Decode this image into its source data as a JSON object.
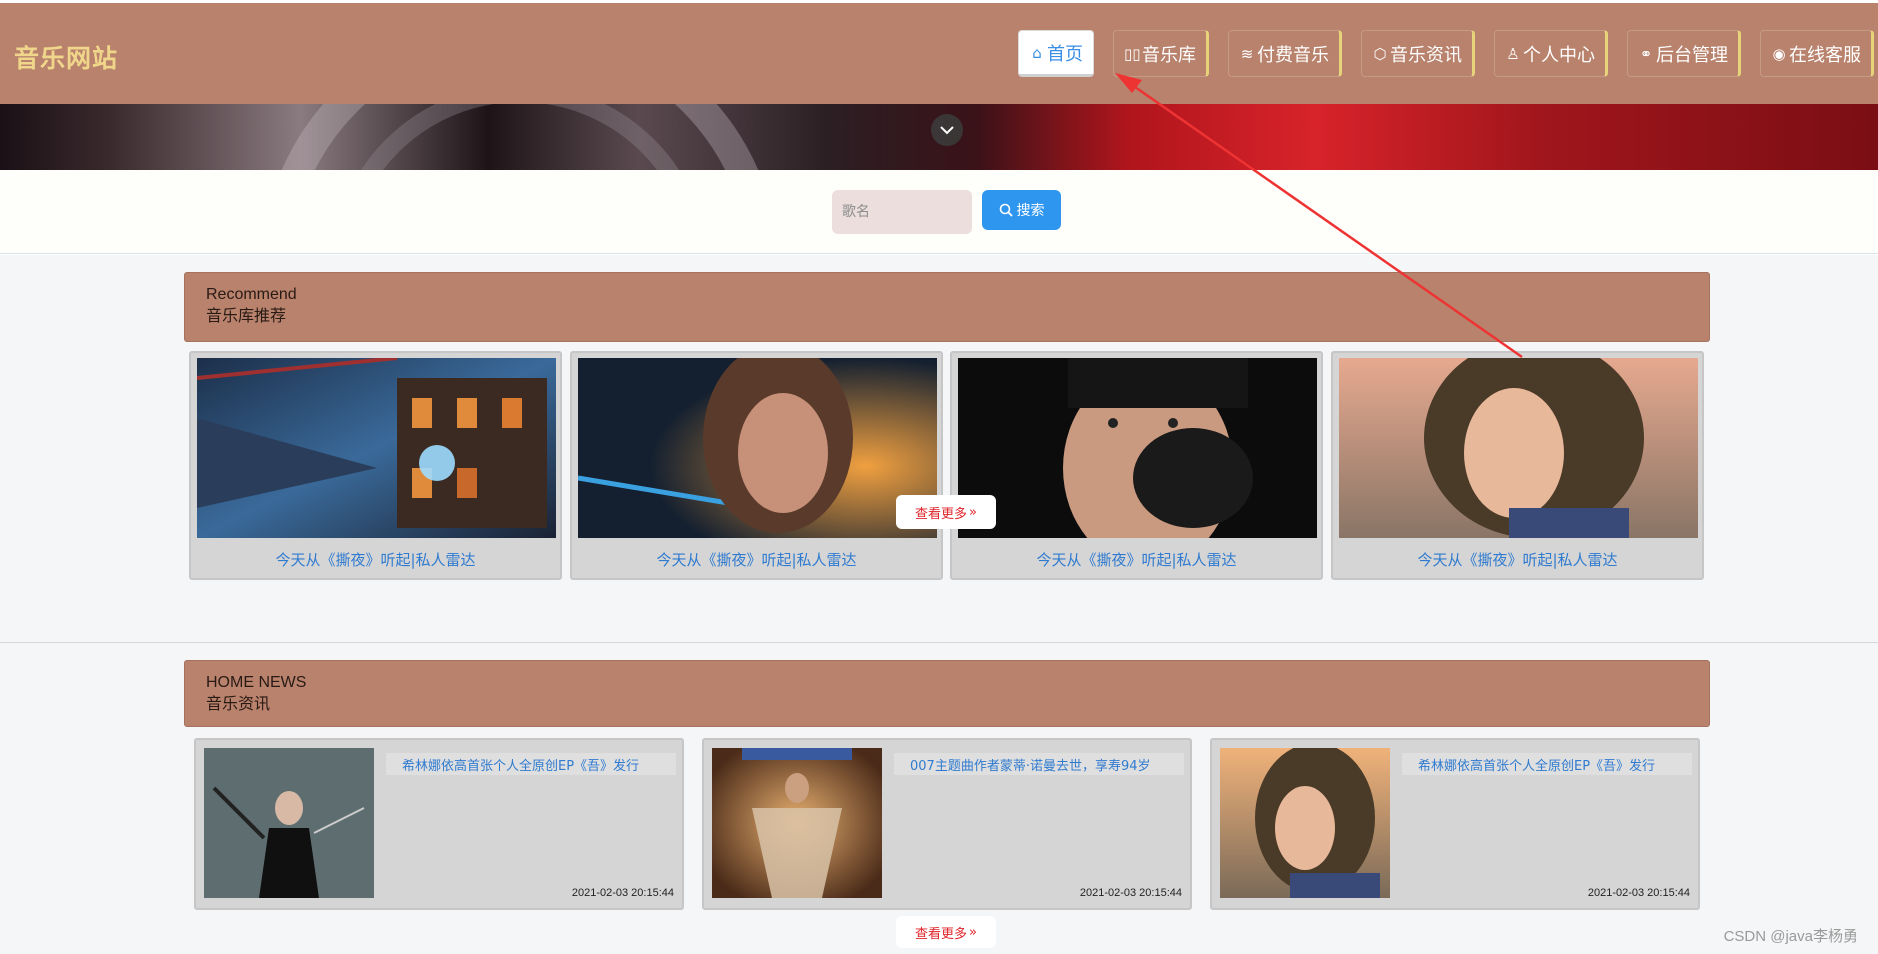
{
  "header": {
    "brand": "音乐网站",
    "nav": [
      {
        "label": "首页",
        "icon": "home-icon",
        "glyph": "⌂"
      },
      {
        "label": "音乐库",
        "icon": "columns-icon",
        "glyph": "▯▯"
      },
      {
        "label": "付费音乐",
        "icon": "layers-icon",
        "glyph": "≋"
      },
      {
        "label": "音乐资讯",
        "icon": "box-icon",
        "glyph": "⬡"
      },
      {
        "label": "个人中心",
        "icon": "user-icon",
        "glyph": "♙"
      },
      {
        "label": "后台管理",
        "icon": "link-icon",
        "glyph": "⚭"
      },
      {
        "label": "在线客服",
        "icon": "headset-icon",
        "glyph": "◉"
      }
    ]
  },
  "search": {
    "placeholder": "歌名",
    "button_label": "搜索"
  },
  "recommend": {
    "title_en": "Recommend",
    "title_cn": "音乐库推荐",
    "items": [
      {
        "caption": "今天从《撕夜》听起|私人雷达"
      },
      {
        "caption": "今天从《撕夜》听起|私人雷达"
      },
      {
        "caption": "今天从《撕夜》听起|私人雷达"
      },
      {
        "caption": "今天从《撕夜》听起|私人雷达"
      }
    ],
    "more_label": "查看更多"
  },
  "news": {
    "title_en": "HOME NEWS",
    "title_cn": "音乐资讯",
    "items": [
      {
        "title": "希林娜依高首张个人全原创EP《吾》发行",
        "time": "2021-02-03 20:15:44"
      },
      {
        "title": "007主题曲作者蒙蒂·诺曼去世，享寿94岁",
        "time": "2021-02-03 20:15:44"
      },
      {
        "title": "希林娜依高首张个人全原创EP《吾》发行",
        "time": "2021-02-03 20:15:44"
      }
    ],
    "more_label": "查看更多"
  },
  "watermark": "CSDN @java李杨勇",
  "colors": {
    "header": "#b8826d",
    "brand": "#f0d68a",
    "link": "#2f7bd0",
    "search_button": "#2f96f0",
    "more": "#e0232a",
    "annotation_arrow": "#ee3333"
  }
}
